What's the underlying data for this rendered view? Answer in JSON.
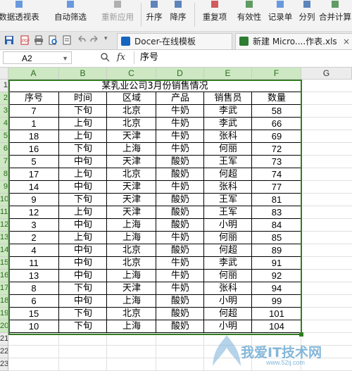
{
  "ribbon": {
    "items": [
      {
        "label": "数据透视表",
        "name": "pivot-table-button",
        "icon": "pivot-table-icon",
        "dim": false
      },
      {
        "label": "自动筛选",
        "name": "auto-filter-button",
        "icon": "filter-icon",
        "dim": false
      },
      {
        "label": "重新应用",
        "name": "reapply-button",
        "icon": "reapply-icon",
        "dim": true
      },
      {
        "label": "升序",
        "name": "sort-ascending-button",
        "icon": "sort-ascending-icon",
        "dim": false
      },
      {
        "label": "降序",
        "name": "sort-descending-button",
        "icon": "sort-descending-icon",
        "dim": false
      },
      {
        "label": "重复项",
        "name": "duplicates-button",
        "icon": "duplicates-icon",
        "dim": false
      },
      {
        "label": "有效性",
        "name": "validity-button",
        "icon": "validity-icon",
        "dim": false
      },
      {
        "label": "记录单",
        "name": "record-form-button",
        "icon": "record-form-icon",
        "dim": false
      },
      {
        "label": "分列",
        "name": "text-to-columns-button",
        "icon": "split-columns-icon",
        "dim": false
      },
      {
        "label": "合并计算",
        "name": "consolidate-button",
        "icon": "consolidate-icon",
        "dim": false
      }
    ]
  },
  "tabs": [
    {
      "label": "Docer-在线模板",
      "icon": "docer-icon",
      "color": "#1565c0"
    },
    {
      "label": "新建 Micro....作表.xls",
      "icon": "excel-file-icon",
      "color": "#2e7d32",
      "close": "×"
    }
  ],
  "formula_bar": {
    "name_box": "A2",
    "fx": "fx",
    "content": "序号"
  },
  "columns": [
    "A",
    "B",
    "C",
    "D",
    "E",
    "F",
    "G"
  ],
  "row_numbers": [
    "1",
    "2",
    "3",
    "4",
    "5",
    "6",
    "7",
    "8",
    "9",
    "10",
    "11",
    "12",
    "13",
    "14",
    "15",
    "16",
    "17",
    "18",
    "19",
    "20",
    "21",
    "22",
    "23"
  ],
  "sheet": {
    "title": "某乳业公司3月份销售情况",
    "headers": [
      "序号",
      "时间",
      "区域",
      "产品",
      "销售员",
      "数量"
    ],
    "rows": [
      [
        "7",
        "下旬",
        "北京",
        "牛奶",
        "李武",
        "58"
      ],
      [
        "1",
        "上旬",
        "北京",
        "牛奶",
        "李武",
        "66"
      ],
      [
        "18",
        "上旬",
        "天津",
        "牛奶",
        "张科",
        "69"
      ],
      [
        "16",
        "下旬",
        "上海",
        "牛奶",
        "何丽",
        "72"
      ],
      [
        "5",
        "中旬",
        "天津",
        "酸奶",
        "王军",
        "73"
      ],
      [
        "17",
        "上旬",
        "北京",
        "酸奶",
        "何超",
        "74"
      ],
      [
        "14",
        "中旬",
        "天津",
        "牛奶",
        "张科",
        "77"
      ],
      [
        "9",
        "下旬",
        "天津",
        "酸奶",
        "王军",
        "81"
      ],
      [
        "12",
        "上旬",
        "天津",
        "酸奶",
        "王军",
        "83"
      ],
      [
        "3",
        "中旬",
        "上海",
        "酸奶",
        "小明",
        "84"
      ],
      [
        "2",
        "上旬",
        "上海",
        "牛奶",
        "何丽",
        "85"
      ],
      [
        "4",
        "中旬",
        "北京",
        "酸奶",
        "何超",
        "89"
      ],
      [
        "11",
        "中旬",
        "北京",
        "牛奶",
        "李武",
        "91"
      ],
      [
        "13",
        "中旬",
        "上海",
        "牛奶",
        "何丽",
        "92"
      ],
      [
        "8",
        "下旬",
        "天津",
        "牛奶",
        "张科",
        "94"
      ],
      [
        "6",
        "中旬",
        "上海",
        "酸奶",
        "小明",
        "99"
      ],
      [
        "15",
        "下旬",
        "北京",
        "酸奶",
        "何超",
        "101"
      ],
      [
        "10",
        "下旬",
        "上海",
        "酸奶",
        "小明",
        "104"
      ]
    ]
  },
  "watermark": {
    "text": "我爱IT技术网",
    "url": "www.52ij.com"
  },
  "colors": {
    "selection": "#2f7d1f",
    "header_selected": "#cde8c2"
  }
}
